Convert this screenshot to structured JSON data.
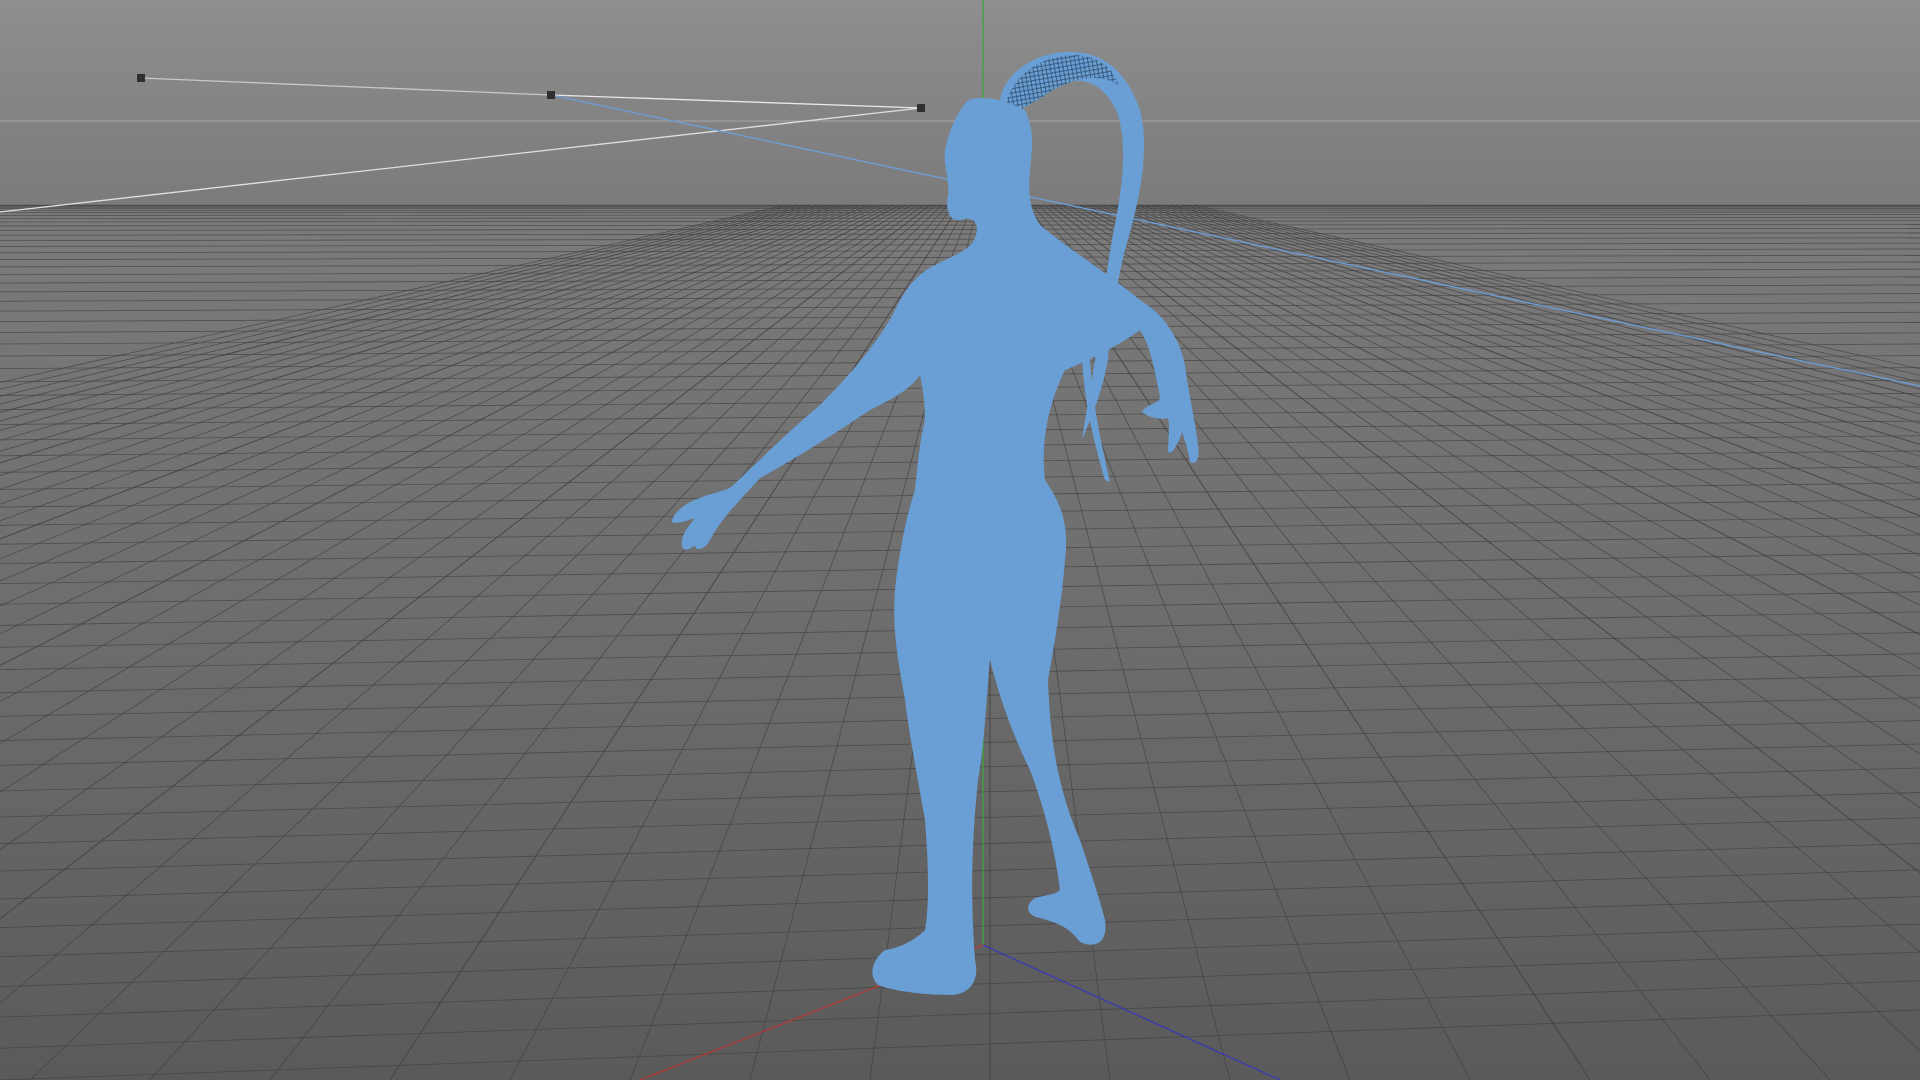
{
  "viewport": {
    "colors": {
      "background_top": "#8c8c8c",
      "background_horizon": "#7a7a7a",
      "background_bottom": "#5c5c5c",
      "grid_line": "#3f3f3f",
      "grid_line_major": "#343434",
      "axis_x": "#b23a3a",
      "axis_y": "#3fa33f",
      "axis_z": "#3a3ab5",
      "selection": "#6a9fd6",
      "spline": "#e8e8e8",
      "spline_selected": "#6a9fd6",
      "control_point": "#2f2f2f"
    },
    "objects": {
      "figure": {
        "icon": "figure-mesh",
        "selected": true
      },
      "ponytail": {
        "icon": "hair-mesh",
        "selected": true
      },
      "camera_spline": {
        "icon": "spline-path",
        "points": 3
      }
    }
  }
}
